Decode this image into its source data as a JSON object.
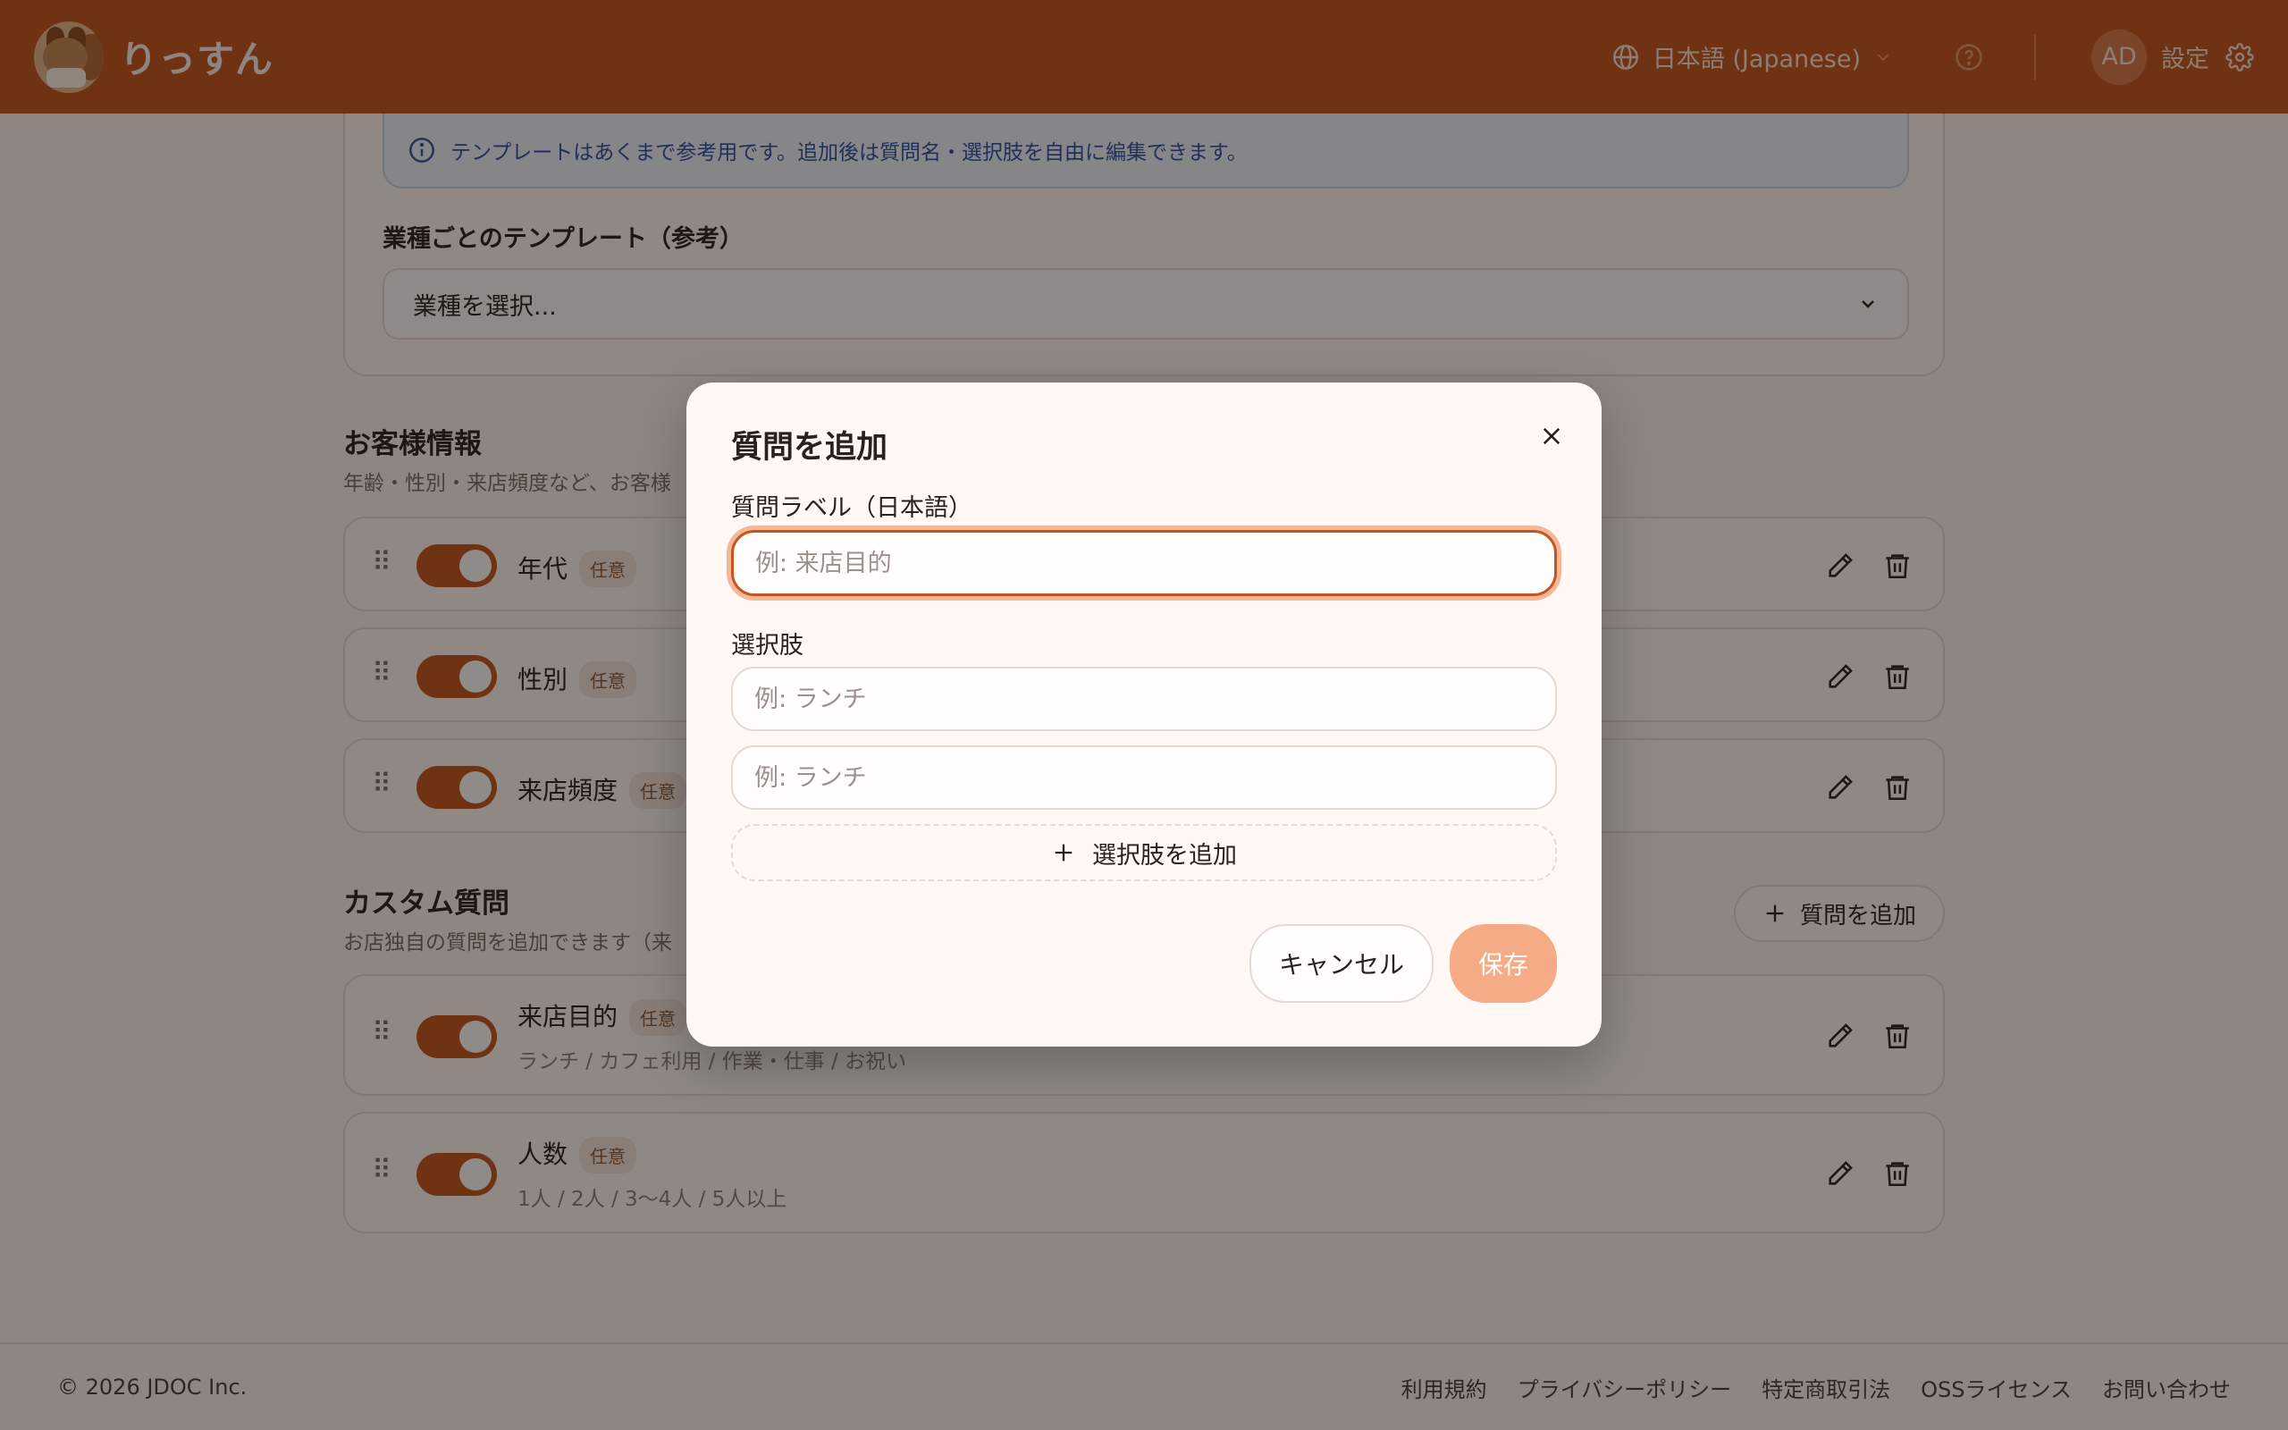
{
  "header": {
    "app_name": "りっすん",
    "language_label": "日本語 (Japanese)",
    "avatar_initials": "AD",
    "settings_label": "設定",
    "bg_color": "#c2561d"
  },
  "template_section": {
    "info_text": "テンプレートはあくまで参考用です。追加後は質問名・選択肢を自由に編集できます。",
    "title": "業種ごとのテンプレート（参考）",
    "select_value": "業種を選択..."
  },
  "customer_section": {
    "title": "お客様情報",
    "subtitle": "年齢・性別・来店頻度など、お客様",
    "items": [
      {
        "label": "年代",
        "tag": "任意"
      },
      {
        "label": "性別",
        "tag": "任意"
      },
      {
        "label": "来店頻度",
        "tag": "任意"
      }
    ]
  },
  "custom_section": {
    "title": "カスタム質問",
    "subtitle": "お店独自の質問を追加できます（来",
    "add_button": "質問を追加",
    "items": [
      {
        "label": "来店目的",
        "tag": "任意",
        "options": "ランチ / カフェ利用 / 作業・仕事 / お祝い"
      },
      {
        "label": "人数",
        "tag": "任意",
        "options": "1人 / 2人 / 3〜4人 / 5人以上"
      }
    ]
  },
  "footer": {
    "copyright": "© 2026 JDOC Inc.",
    "links": [
      "利用規約",
      "プライバシーポリシー",
      "特定商取引法",
      "OSSライセンス",
      "お問い合わせ"
    ]
  },
  "modal": {
    "title": "質問を追加",
    "label_field": "質問ラベル（日本語）",
    "label_placeholder": "例: 来店目的",
    "label_value": "",
    "options_label": "選択肢",
    "option_placeholder_1": "例: ランチ",
    "option_placeholder_2": "例: ランチ",
    "add_option": "選択肢を追加",
    "cancel": "キャンセル",
    "save": "保存"
  }
}
